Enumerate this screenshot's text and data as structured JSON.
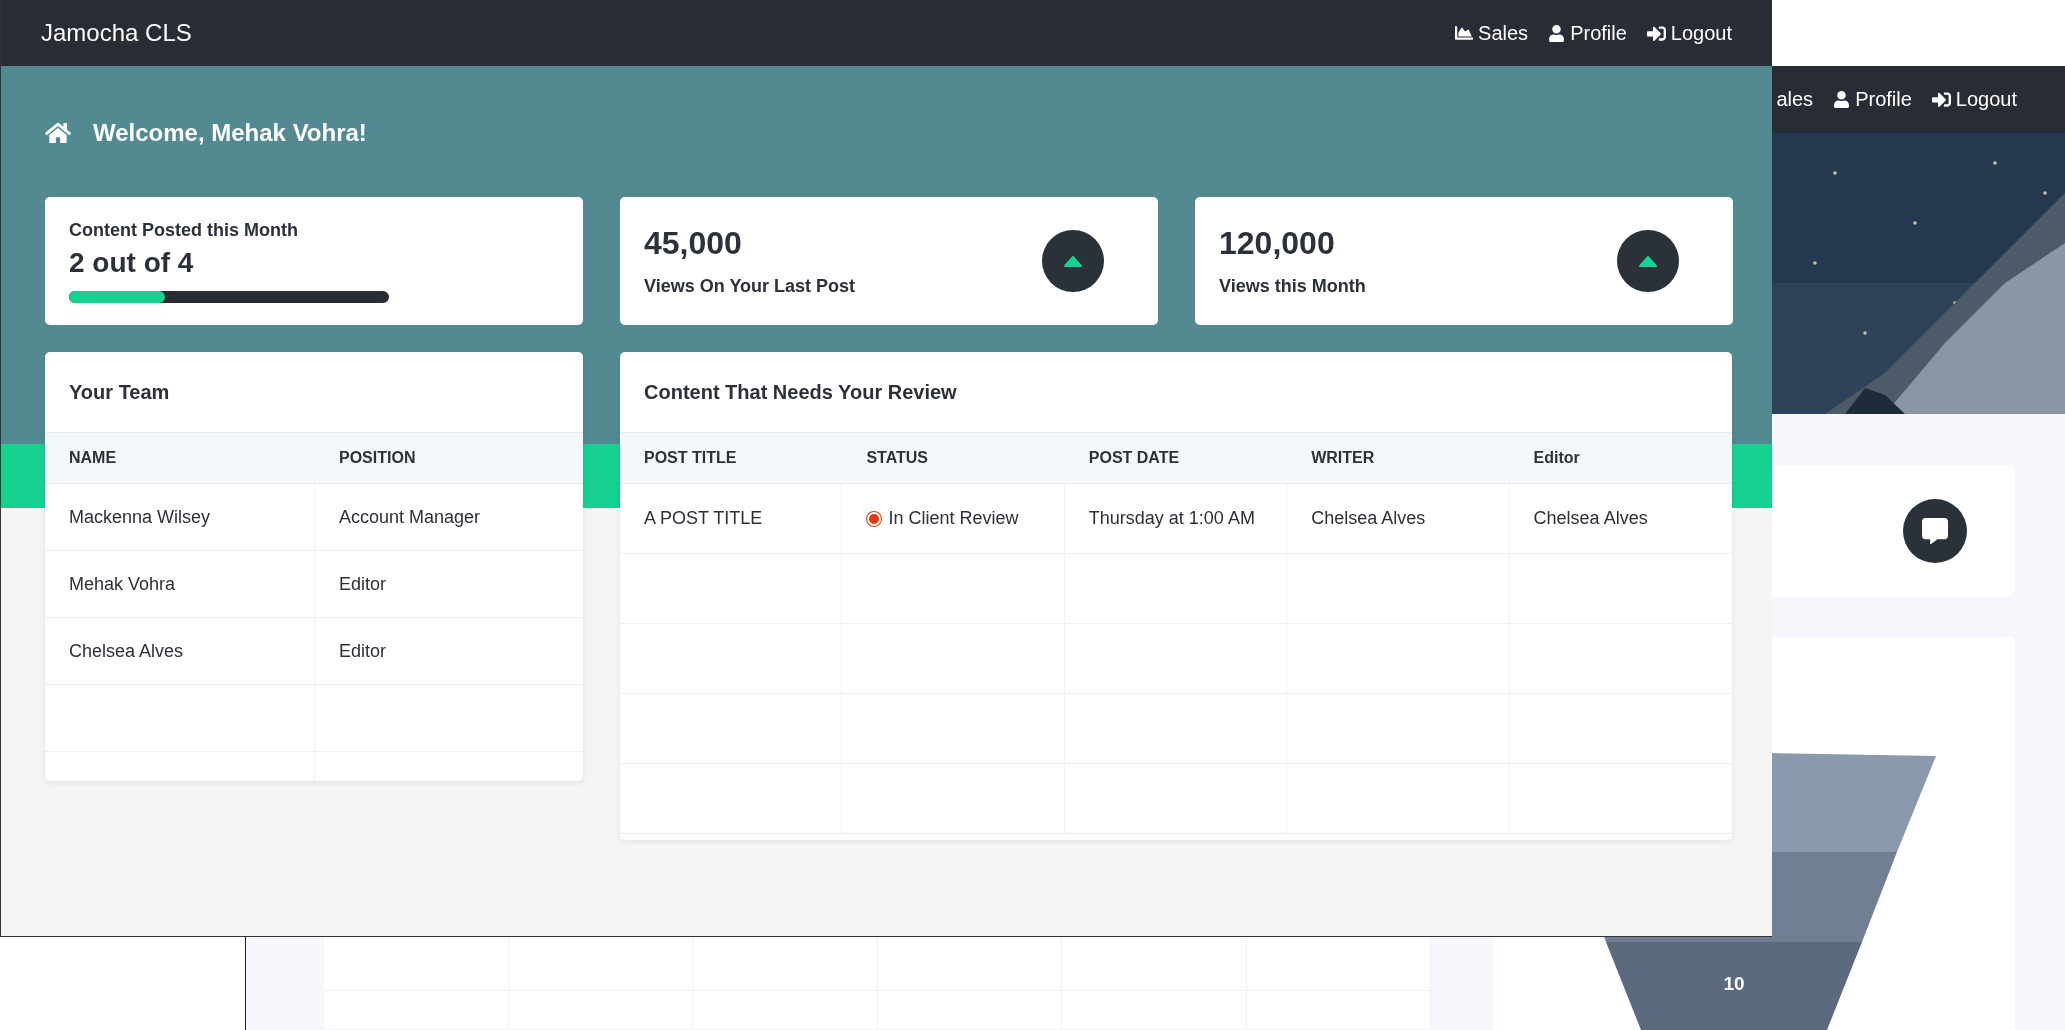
{
  "app": {
    "brand": "Jamocha CLS",
    "nav": [
      {
        "label": "Sales"
      },
      {
        "label": "Profile"
      },
      {
        "label": "Logout"
      }
    ]
  },
  "welcome": "Welcome, Mehak Vohra!",
  "stats": [
    {
      "kind": "progress",
      "label": "Content Posted this Month",
      "value": "2 out of 4",
      "level": 0.3
    },
    {
      "kind": "trend",
      "value": "45,000",
      "label": "Views On Your Last Post"
    },
    {
      "kind": "trend",
      "value": "120,000",
      "label": "Views this Month"
    }
  ],
  "team": {
    "title": "Your Team",
    "columns": [
      "NAME",
      "POSITION"
    ],
    "rows": [
      [
        "Mackenna Wilsey",
        "Account Manager"
      ],
      [
        "Mehak Vohra",
        "Editor"
      ],
      [
        "Chelsea Alves",
        "Editor"
      ]
    ]
  },
  "review": {
    "title": "Content That Needs Your Review",
    "columns": [
      "POST TITLE",
      "STATUS",
      "POST DATE",
      "WRITER",
      "Editor"
    ],
    "rows": [
      {
        "post_title": "A POST TITLE",
        "status": {
          "label": "In Client Review",
          "color": "#e4380c"
        },
        "post_date": "Thursday at 1:00 AM",
        "writer": "Chelsea Alves",
        "editor": "Chelsea Alves"
      }
    ]
  },
  "background_page": {
    "nav": [
      {
        "label": "ales"
      },
      {
        "label": "Profile"
      },
      {
        "label": "Logout"
      }
    ],
    "funnel_label": "10"
  }
}
